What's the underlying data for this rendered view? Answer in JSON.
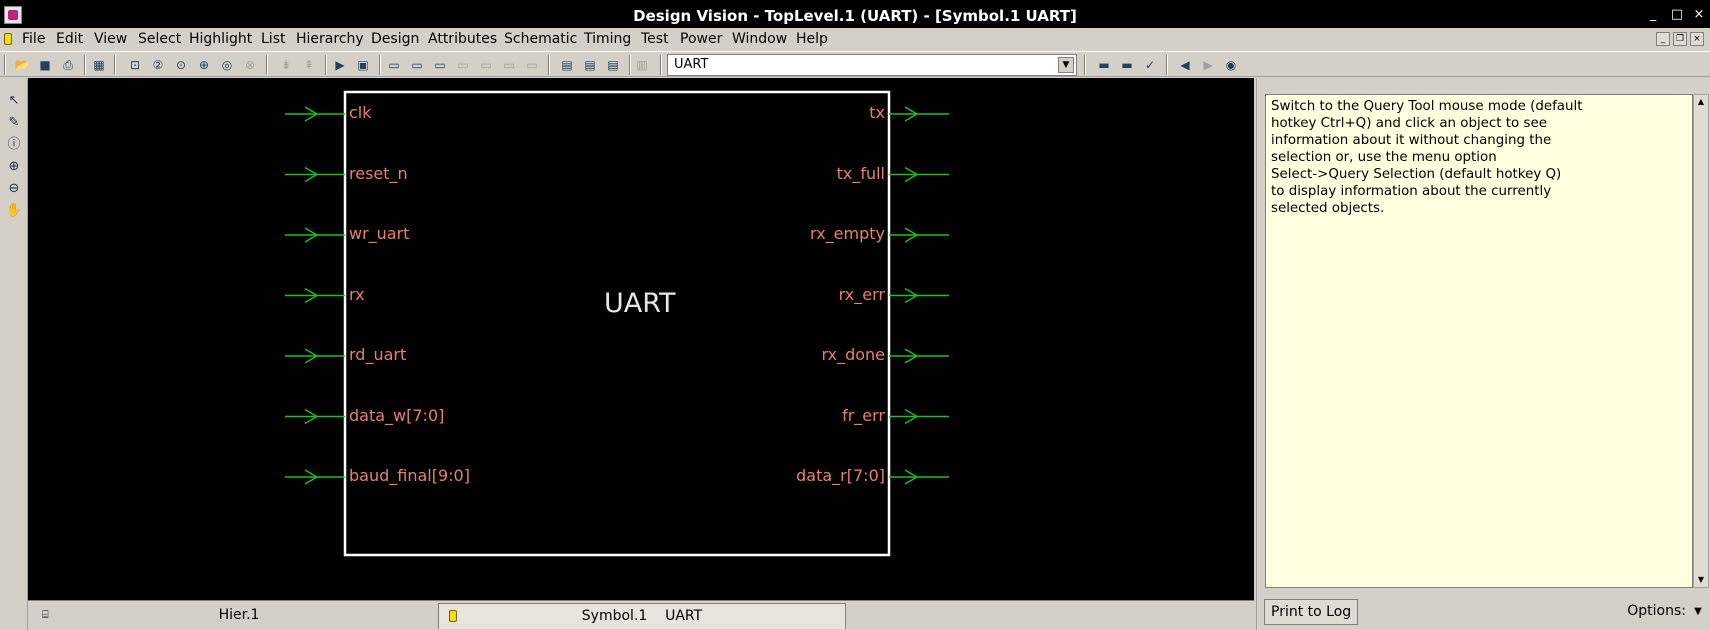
{
  "window": {
    "title": "Design Vision - TopLevel.1 (UART) - [Symbol.1    UART]",
    "controls": [
      "_",
      "□",
      "×"
    ]
  },
  "menubar": {
    "items": [
      "File",
      "Edit",
      "View",
      "Select",
      "Highlight",
      "List",
      "Hierarchy",
      "Design",
      "Attributes",
      "Schematic",
      "Timing",
      "Test",
      "Power",
      "Window",
      "Help"
    ]
  },
  "toolbar": {
    "design_select_value": "UART"
  },
  "canvas": {
    "symbol_name": "UART",
    "input_pins": [
      "clk",
      "reset_n",
      "wr_uart",
      "rx",
      "rd_uart",
      "data_w[7:0]",
      "baud_final[9:0]"
    ],
    "output_pins": [
      "tx",
      "tx_full",
      "rx_empty",
      "rx_err",
      "rx_done",
      "fr_err",
      "data_r[7:0]"
    ],
    "colors": {
      "background": "#000000",
      "box": "#ffffff",
      "wire": "#20c020",
      "pin_text": "#e88070",
      "symbol_text": "#e6e6e6"
    }
  },
  "tabs": {
    "hier": "Hier.1",
    "symbol": "Symbol.1    UART"
  },
  "query_panel": {
    "text": "Switch to the Query Tool mouse mode (default\nhotkey Ctrl+Q) and click an object to see\ninformation about it without changing the\nselection or, use the menu option\nSelect->Query Selection (default hotkey Q)\nto display information about the currently\nselected objects.",
    "print_button": "Print to Log",
    "options_label": "Options:"
  }
}
